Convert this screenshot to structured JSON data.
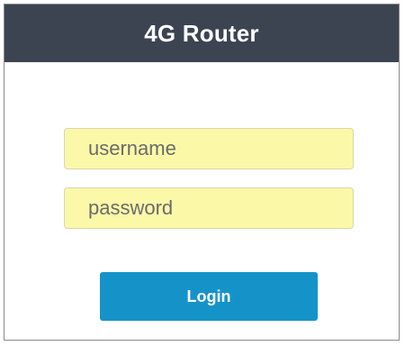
{
  "header": {
    "title": "4G Router",
    "background": "#3c4452"
  },
  "form": {
    "username": {
      "value": "",
      "placeholder": "username"
    },
    "password": {
      "value": "",
      "placeholder": "password"
    },
    "field_color": "#fbf8a8",
    "login_label": "Login",
    "login_color": "#1593c9"
  }
}
